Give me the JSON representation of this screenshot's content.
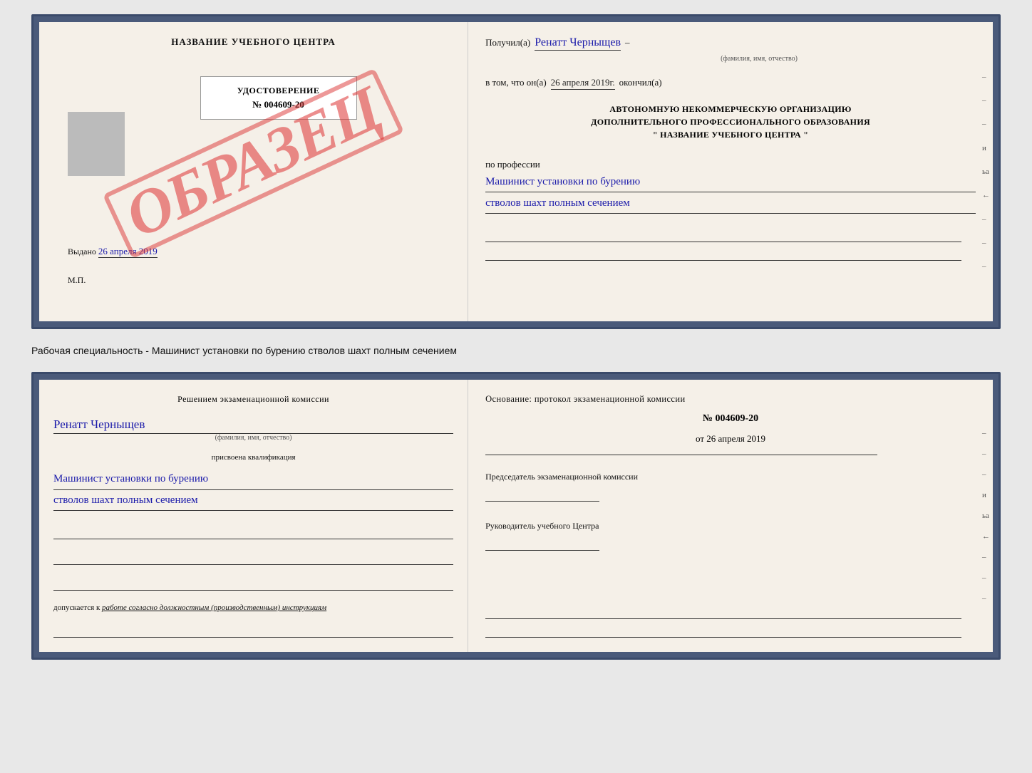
{
  "top_doc": {
    "left": {
      "title": "НАЗВАНИЕ УЧЕБНОГО ЦЕНТРА",
      "stamp": "ОБРАЗЕЦ",
      "udostoverenie_title": "УДОСТОВЕРЕНИЕ",
      "udostoverenie_number": "№ 004609-20",
      "vydano_label": "Выдано",
      "vydano_date": "26 апреля 2019",
      "mp": "М.П."
    },
    "right": {
      "poluchil_label": "Получил(а)",
      "poluchil_name": "Ренатт Черныщев",
      "fio_subtext": "(фамилия, имя, отчество)",
      "vtom_label": "в том, что он(а)",
      "vtom_date": "26 апреля 2019г.",
      "okonchil_label": "окончил(а)",
      "block_line1": "АВТОНОМНУЮ НЕКОММЕРЧЕСКУЮ ОРГАНИЗАЦИЮ",
      "block_line2": "ДОПОЛНИТЕЛЬНОГО ПРОФЕССИОНАЛЬНОГО ОБРАЗОВАНИЯ",
      "block_line3": "\" НАЗВАНИЕ УЧЕБНОГО ЦЕНТРА \"",
      "po_professii_label": "по профессии",
      "profession1": "Машинист установки по бурению",
      "profession2": "стволов шахт полным сечением",
      "right_chars": [
        "–",
        "–",
        "–",
        "и",
        "ьа",
        "←",
        "–",
        "–",
        "–"
      ]
    }
  },
  "separator": {
    "text": "Рабочая специальность - Машинист установки по бурению стволов шахт полным сечением"
  },
  "bottom_doc": {
    "left": {
      "resheniem_label": "Решением экзаменационной комиссии",
      "name": "Ренатт Черныщев",
      "fio_subtext": "(фамилия, имя, отчество)",
      "prisvoena_label": "присвоена квалификация",
      "kvali1": "Машинист установки по бурению",
      "kvali2": "стволов шахт полным сечением",
      "dopuskaetsya_label": "допускается к",
      "dopusk_text": "работе согласно должностным (производственным) инструкциям"
    },
    "right": {
      "osnovanie_label": "Основание: протокол экзаменационной комиссии",
      "protocol_number": "№ 004609-20",
      "protocol_date_prefix": "от",
      "protocol_date": "26 апреля 2019",
      "predsedatel_label": "Председатель экзаменационной комиссии",
      "rukovoditel_label": "Руководитель учебного Центра",
      "right_chars": [
        "–",
        "–",
        "–",
        "и",
        "ьа",
        "←",
        "–",
        "–",
        "–"
      ]
    }
  }
}
